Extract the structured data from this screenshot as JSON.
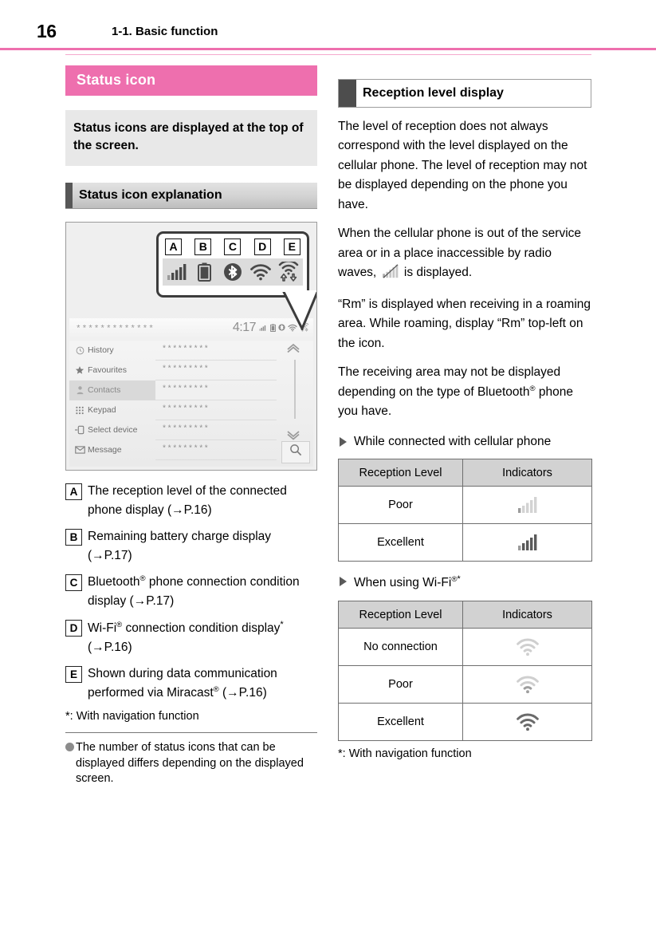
{
  "header": {
    "page_number": "16",
    "section_title": "1-1. Basic function",
    "rule_color": "#ee6fae"
  },
  "left": {
    "banner_title": "Status icon",
    "lead_text": "Status icons are displayed at the top of the screen.",
    "subhead_title": "Status icon explanation",
    "illustration": {
      "callout_letters": [
        "A",
        "B",
        "C",
        "D",
        "E"
      ],
      "callout_icons": [
        "signal-bars-icon",
        "battery-icon",
        "bluetooth-icon",
        "wifi-icon",
        "miracast-icon"
      ],
      "head_unit": {
        "title_placeholder": "*************",
        "time": "4:17",
        "status_icons": [
          "signal-bars-icon",
          "battery-icon",
          "bluetooth-icon",
          "wifi-icon",
          "miracast-icon"
        ],
        "rows": [
          {
            "icon": "clock-icon",
            "label": "History",
            "value": "*********"
          },
          {
            "icon": "star-icon",
            "label": "Favourites",
            "value": "*********"
          },
          {
            "icon": "contacts-icon",
            "label": "Contacts",
            "value": "*********",
            "selected": true
          },
          {
            "icon": "keypad-icon",
            "label": "Keypad",
            "value": "*********"
          },
          {
            "icon": "select-device-icon",
            "label": "Select device",
            "value": "*********"
          },
          {
            "icon": "message-icon",
            "label": "Message",
            "value": "*********"
          }
        ],
        "scroll_up": "chevron-up-icon",
        "scroll_down": "chevron-down-icon",
        "search": "search-icon"
      }
    },
    "legend": [
      {
        "key": "A",
        "text_html": "The reception level of the connected phone display (→P.16)"
      },
      {
        "key": "B",
        "text_html": "Remaining battery charge display (→P.17)"
      },
      {
        "key": "C",
        "text_html": "Bluetooth<sup class=\"reg\">®</sup> phone connection condition display (→P.17)"
      },
      {
        "key": "D",
        "text_html": "Wi-Fi<sup class=\"reg\">®</sup> connection condition display<sup class=\"ast\">*</sup> (→P.16)"
      },
      {
        "key": "E",
        "text_html": "Shown during data communication performed via Miracast<sup class=\"reg\">®</sup> (→P.16)"
      }
    ],
    "legend_footnote": "*: With navigation function",
    "note_text": "The number of status icons that can be displayed differs depending on the displayed screen."
  },
  "right": {
    "subhead_title": "Reception level display",
    "paragraphs": [
      {
        "html": "The level of reception does not always correspond with the level displayed on the cellular phone. The level of reception may not be displayed depending on the phone you have."
      },
      {
        "html": "When the cellular phone is out of the service area or in a place inaccessible by radio waves, [NO_SIGNAL_ICON] is displayed."
      },
      {
        "html": "“Rm” is displayed when receiving in a roaming area. While roaming, display “Rm” top-left on the icon."
      },
      {
        "html": "The receiving area may not be displayed depending on the type of Bluetooth<sup class=\"reg\">®</sup> phone you have."
      }
    ],
    "section_1": {
      "heading_html": "While connected with cellular phone",
      "table": {
        "headers": [
          "Reception Level",
          "Indicators"
        ],
        "rows": [
          {
            "level": "Poor",
            "indicator": "signal-bars-icon",
            "strength": 1
          },
          {
            "level": "Excellent",
            "indicator": "signal-bars-icon",
            "strength": 5
          }
        ]
      }
    },
    "section_2": {
      "heading_html": "When using Wi-Fi<sup class=\"reg\">®</sup><sup class=\"ast\">*</sup>",
      "table": {
        "headers": [
          "Reception Level",
          "Indicators"
        ],
        "rows": [
          {
            "level": "No connection",
            "indicator": "wifi-icon",
            "strength": 0
          },
          {
            "level": "Poor",
            "indicator": "wifi-icon",
            "strength": 1
          },
          {
            "level": "Excellent",
            "indicator": "wifi-icon",
            "strength": 3
          }
        ]
      }
    },
    "footnote": "*: With navigation function"
  }
}
